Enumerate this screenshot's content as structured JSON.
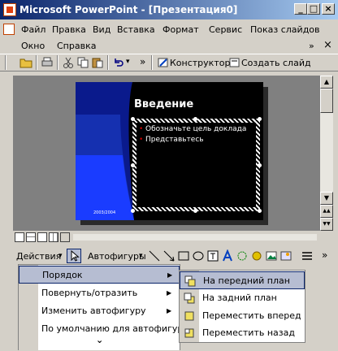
{
  "window": {
    "title": "Microsoft PowerPoint - [Презентация0]",
    "min_glyph": "_",
    "max_glyph": "□",
    "close_glyph": "×"
  },
  "menubar": {
    "items": [
      "Файл",
      "Правка",
      "Вид",
      "Вставка",
      "Формат",
      "Сервис",
      "Показ слайдов",
      "Окно",
      "Справка"
    ],
    "overflow": "»",
    "close_glyph": "×"
  },
  "standard_toolbar": {
    "overflow": "»",
    "undo_dropdown": "▾",
    "designer_label": "Конструктор",
    "new_slide_label": "Создать слайд"
  },
  "slide": {
    "title": "Введение",
    "bullets": [
      "Обозначьте цель доклада",
      "Представьтесь"
    ],
    "footer_date": "2003/2004",
    "colors": {
      "background": "#000000",
      "band_dark": "#0a1a8c",
      "band_light": "#1a3cff",
      "placeholder_border": "#ffffff"
    }
  },
  "scrollbar": {
    "up": "▲",
    "down": "▼",
    "prev_slide": "▲▲",
    "next_slide": "▼▼"
  },
  "view_bar": {},
  "drawing_toolbar": {
    "actions_label": "Действия",
    "actions_arrow": "▾",
    "autoshapes_label": "Автофигуры",
    "autoshapes_arrow": "▾",
    "overflow": "»"
  },
  "actions_menu": {
    "items": [
      {
        "label": "Порядок",
        "submenu": "▶"
      },
      {
        "label": "Повернуть/отразить",
        "submenu": "▶"
      },
      {
        "label": "Изменить автофигуру",
        "submenu": "▶"
      },
      {
        "label": "По умолчанию для автофигур",
        "submenu": ""
      }
    ],
    "more": "⌄"
  },
  "order_submenu": {
    "items": [
      {
        "label": "На передний план"
      },
      {
        "label": "На задний план"
      },
      {
        "label": "Переместить вперед"
      },
      {
        "label": "Переместить назад"
      }
    ]
  }
}
